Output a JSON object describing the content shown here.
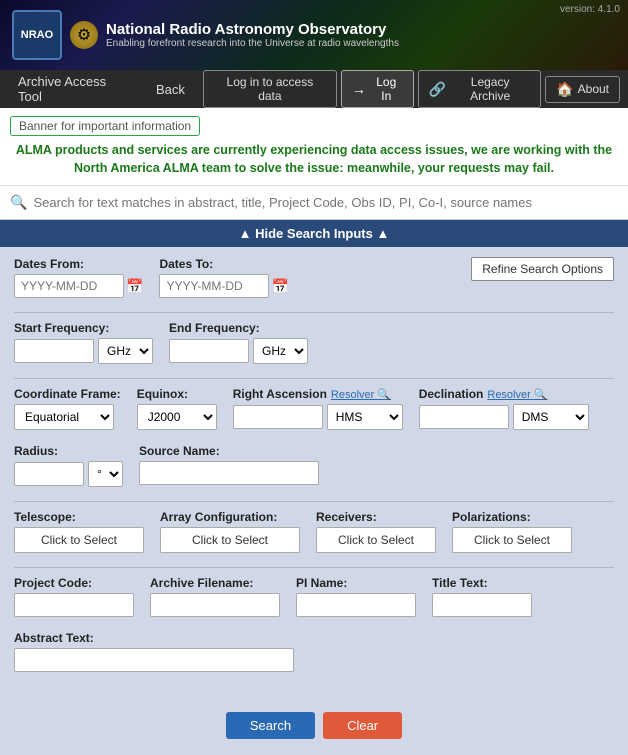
{
  "version": "version: 4.1.0",
  "header": {
    "title": "National Radio Astronomy Observatory",
    "subtitle": "Enabling forefront research into the Universe at radio wavelengths",
    "nrao_text": "NRAO"
  },
  "navbar": {
    "archive_access": "Archive Access Tool",
    "back": "Back",
    "login_to_data": "Log in to access data",
    "login": "Log In",
    "legacy_archive": "Legacy Archive",
    "about": "About"
  },
  "banner": {
    "box_label": "Banner for important information",
    "message": "ALMA products and services are currently experiencing data access issues, we are working with the North America ALMA team to solve the issue: meanwhile, your requests may fail."
  },
  "search": {
    "placeholder": "Search for text matches in abstract, title, Project Code, Obs ID, PI, Co-I, source names",
    "panel_toggle": "▲ Hide Search Inputs ▲",
    "refine_options": "Refine Search Options"
  },
  "form": {
    "dates_from_label": "Dates From:",
    "dates_from_placeholder": "YYYY-MM-DD",
    "dates_to_label": "Dates To:",
    "dates_to_placeholder": "YYYY-MM-DD",
    "start_frequency_label": "Start Frequency:",
    "end_frequency_label": "End Frequency:",
    "freq_unit": "GHz",
    "coordinate_frame_label": "Coordinate Frame:",
    "equatorial_option": "Equatorial",
    "equinox_label": "Equinox:",
    "j2000_option": "J2000",
    "right_ascension_label": "Right Ascension",
    "declination_label": "Declination",
    "resolver_label": "Resolver",
    "hms_label": "HMS",
    "dms_label": "DMS",
    "radius_label": "Radius:",
    "source_name_label": "Source Name:",
    "telescope_label": "Telescope:",
    "array_config_label": "Array Configuration:",
    "receivers_label": "Receivers:",
    "polarizations_label": "Polarizations:",
    "click_to_select": "Click to Select",
    "project_code_label": "Project Code:",
    "archive_filename_label": "Archive Filename:",
    "pi_name_label": "PI Name:",
    "title_text_label": "Title Text:",
    "abstract_text_label": "Abstract Text:",
    "search_button": "Search",
    "clear_button": "Clear"
  }
}
